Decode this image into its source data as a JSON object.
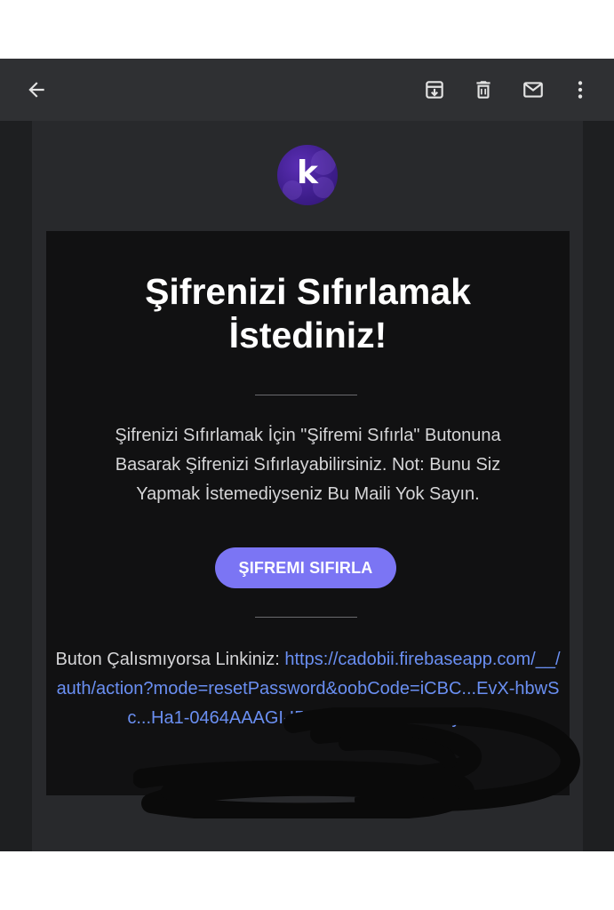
{
  "toolbar": {
    "icons": {
      "back": "arrow-back-icon",
      "archive": "archive-icon",
      "delete": "delete-icon",
      "mark_unread": "mail-icon",
      "more": "more-vert-icon"
    }
  },
  "email": {
    "logo_letter": "k",
    "title": "Şifrenizi Sıfırlamak İstediniz!",
    "body": "Şifrenizi Sıfırlamak İçin \"Şifremi Sıfırla\" Butonuna Basarak Şifrenizi Sıfırlayabilirsiniz. Not: Bunu Siz Yapmak İstemediyseniz Bu Maili Yok Sayın.",
    "button_label": "ŞIFREMI SIFIRLA",
    "link_prefix": "Buton Çalısmıyorsa Linkiniz: ",
    "link_text": "https://cadobii.firebaseapp.com/__/auth/action?mode=resetPassword&oobCode=iCBC...EvX-hbwSc...Ha1-0464AAAGI-I5J...&apiKey=AIzaSyC..."
  },
  "colors": {
    "toolbar_bg": "#2f3033",
    "viewer_bg": "#1e1f21",
    "content_bg": "#28292c",
    "card_bg": "#111112",
    "button_bg": "#7b75f4",
    "link": "#6a8ff2",
    "logo_purple": "#4a23a0"
  }
}
